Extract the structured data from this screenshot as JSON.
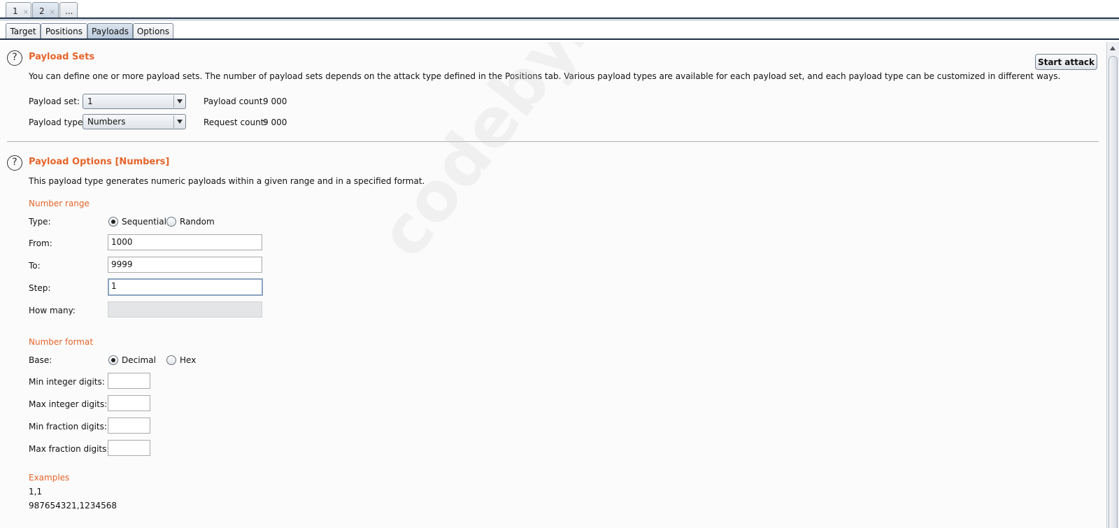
{
  "attack_tabs": [
    {
      "label": "1",
      "close": "×"
    },
    {
      "label": "2",
      "close": "×"
    },
    {
      "label": "..."
    }
  ],
  "sub_tabs": [
    "Target",
    "Positions",
    "Payloads",
    "Options"
  ],
  "active_sub_tab": "Payloads",
  "payload_sets": {
    "title": "Payload Sets",
    "description": "You can define one or more payload sets. The number of payload sets depends on the attack type defined in the Positions tab. Various payload types are available for each payload set, and each payload type can be customized in different ways.",
    "start_attack_label": "Start attack",
    "payload_set_label": "Payload set:",
    "payload_set_value": "1",
    "payload_type_label": "Payload type:",
    "payload_type_value": "Numbers",
    "payload_count_label": "Payload count:",
    "payload_count_value": "9 000",
    "request_count_label": "Request count:",
    "request_count_value": "9 000"
  },
  "payload_options": {
    "title": "Payload Options [Numbers]",
    "description": "This payload type generates numeric payloads within a given range and in a specified format.",
    "number_range": {
      "heading": "Number range",
      "type_label": "Type:",
      "type_options": [
        "Sequential",
        "Random"
      ],
      "type_selected": "Sequential",
      "from_label": "From:",
      "from_value": "1000",
      "to_label": "To:",
      "to_value": "9999",
      "step_label": "Step:",
      "step_value": "1",
      "how_many_label": "How many:",
      "how_many_value": ""
    },
    "number_format": {
      "heading": "Number format",
      "base_label": "Base:",
      "base_options": [
        "Decimal",
        "Hex"
      ],
      "base_selected": "Decimal",
      "min_int_label": "Min integer digits:",
      "max_int_label": "Max integer digits:",
      "min_frac_label": "Min fraction digits:",
      "max_frac_label": "Max fraction digits:"
    },
    "examples": {
      "heading": "Examples",
      "lines": [
        "1,1",
        "987654321,1234568"
      ]
    }
  },
  "watermark": "codeby.net",
  "colors": {
    "accent": "#e5652a",
    "tab_border": "#1e2f46"
  },
  "icons": {
    "help": "help-icon",
    "dropdown": "chevron-down-icon"
  }
}
